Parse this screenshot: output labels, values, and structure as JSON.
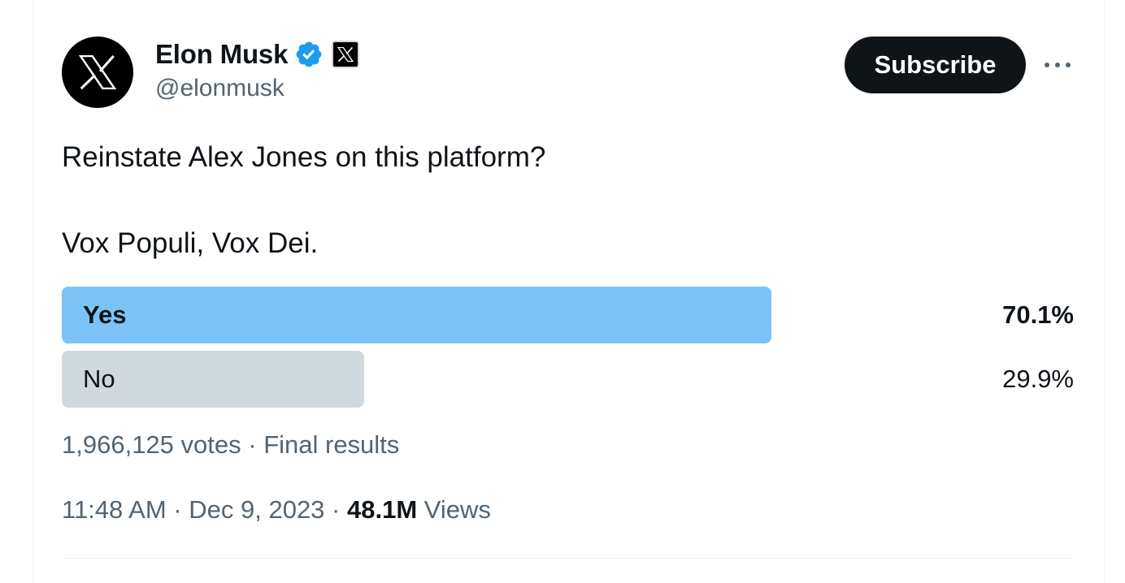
{
  "author": {
    "name": "Elon Musk",
    "handle": "@elonmusk",
    "avatar_icon": "x-logo-icon",
    "verified_icon": "verified-badge-icon",
    "affiliation_icon": "x-affiliate-badge-icon"
  },
  "actions": {
    "subscribe_label": "Subscribe",
    "more_icon": "more-horizontal-icon"
  },
  "tweet": {
    "line1": "Reinstate Alex Jones on this platform?",
    "line2": "Vox Populi, Vox Dei."
  },
  "poll": {
    "options": [
      {
        "label": "Yes",
        "percent_text": "70.1%",
        "percent": 70.1,
        "winner": true
      },
      {
        "label": "No",
        "percent_text": "29.9%",
        "percent": 29.9,
        "winner": false
      }
    ],
    "votes": "1,966,125 votes",
    "separator": " · ",
    "status": "Final results"
  },
  "footer": {
    "time": "11:48 AM",
    "separator": " · ",
    "date": "Dec 9, 2023",
    "views_count": "48.1M",
    "views_label": " Views"
  },
  "colors": {
    "winner_bar": "#7cc3f5",
    "loser_bar": "#cfd9de",
    "verified": "#1d9bf0",
    "secondary_text": "#536471",
    "primary_text": "#0f1419"
  }
}
